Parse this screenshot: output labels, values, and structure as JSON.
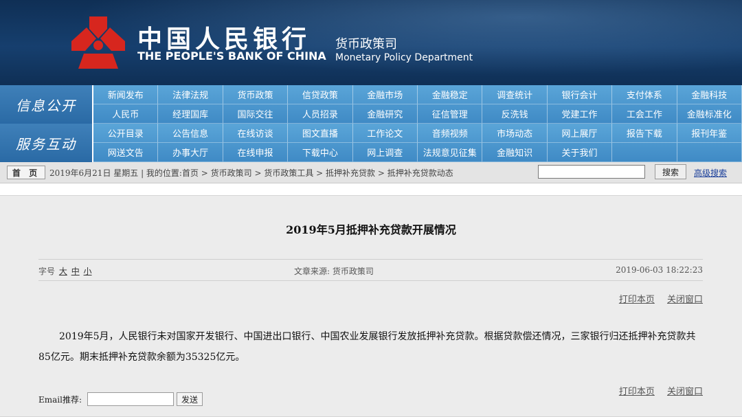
{
  "header": {
    "bank_name_cn": "中国人民银行",
    "bank_name_en": "THE PEOPLE'S BANK OF CHINA",
    "dept_cn": "货币政策司",
    "dept_en": "Monetary Policy Department",
    "emblem_icon": "pboc-emblem-icon",
    "emblem_color": "#d7261e"
  },
  "nav": {
    "groups": [
      {
        "label": "信息公开",
        "items": [
          "新闻发布",
          "法律法规",
          "货币政策",
          "信贷政策",
          "金融市场",
          "金融稳定",
          "调查统计",
          "银行会计",
          "支付体系",
          "金融科技",
          "人民币",
          "经理国库",
          "国际交往",
          "人员招录",
          "金融研究",
          "征信管理",
          "反洗钱",
          "党建工作",
          "工会工作",
          "金融标准化"
        ]
      },
      {
        "label": "服务互动",
        "items": [
          "公开目录",
          "公告信息",
          "在线访谈",
          "图文直播",
          "工作论文",
          "音频视频",
          "市场动态",
          "网上展厅",
          "报告下载",
          "报刊年鉴",
          "网送文告",
          "办事大厅",
          "在线申报",
          "下载中心",
          "网上调查",
          "法规意见征集",
          "金融知识",
          "关于我们",
          "",
          ""
        ]
      }
    ]
  },
  "breadcrumb": {
    "home_label": "首 页",
    "text": "2019年6月21日 星期五 | 我的位置:首页 > 货币政策司 > 货币政策工具 > 抵押补充贷款 > 抵押补充贷款动态",
    "search_button": "搜索",
    "advanced_search": "高级搜索"
  },
  "article": {
    "title": "2019年5月抵押补充贷款开展情况",
    "font_size_label": "字号",
    "font_sizes": [
      "大",
      "中",
      "小"
    ],
    "source": "文章来源: 货币政策司",
    "date": "2019-06-03 18:22:23",
    "print_label": "打印本页",
    "close_label": "关闭窗口",
    "body": "2019年5月，人民银行未对国家开发银行、中国进出口银行、中国农业发展银行发放抵押补充贷款。根据贷款偿还情况，三家银行归还抵押补充贷款共85亿元。期末抵押补充贷款余额为35325亿元。",
    "email_label": "Email推荐:",
    "send_label": "发送"
  }
}
